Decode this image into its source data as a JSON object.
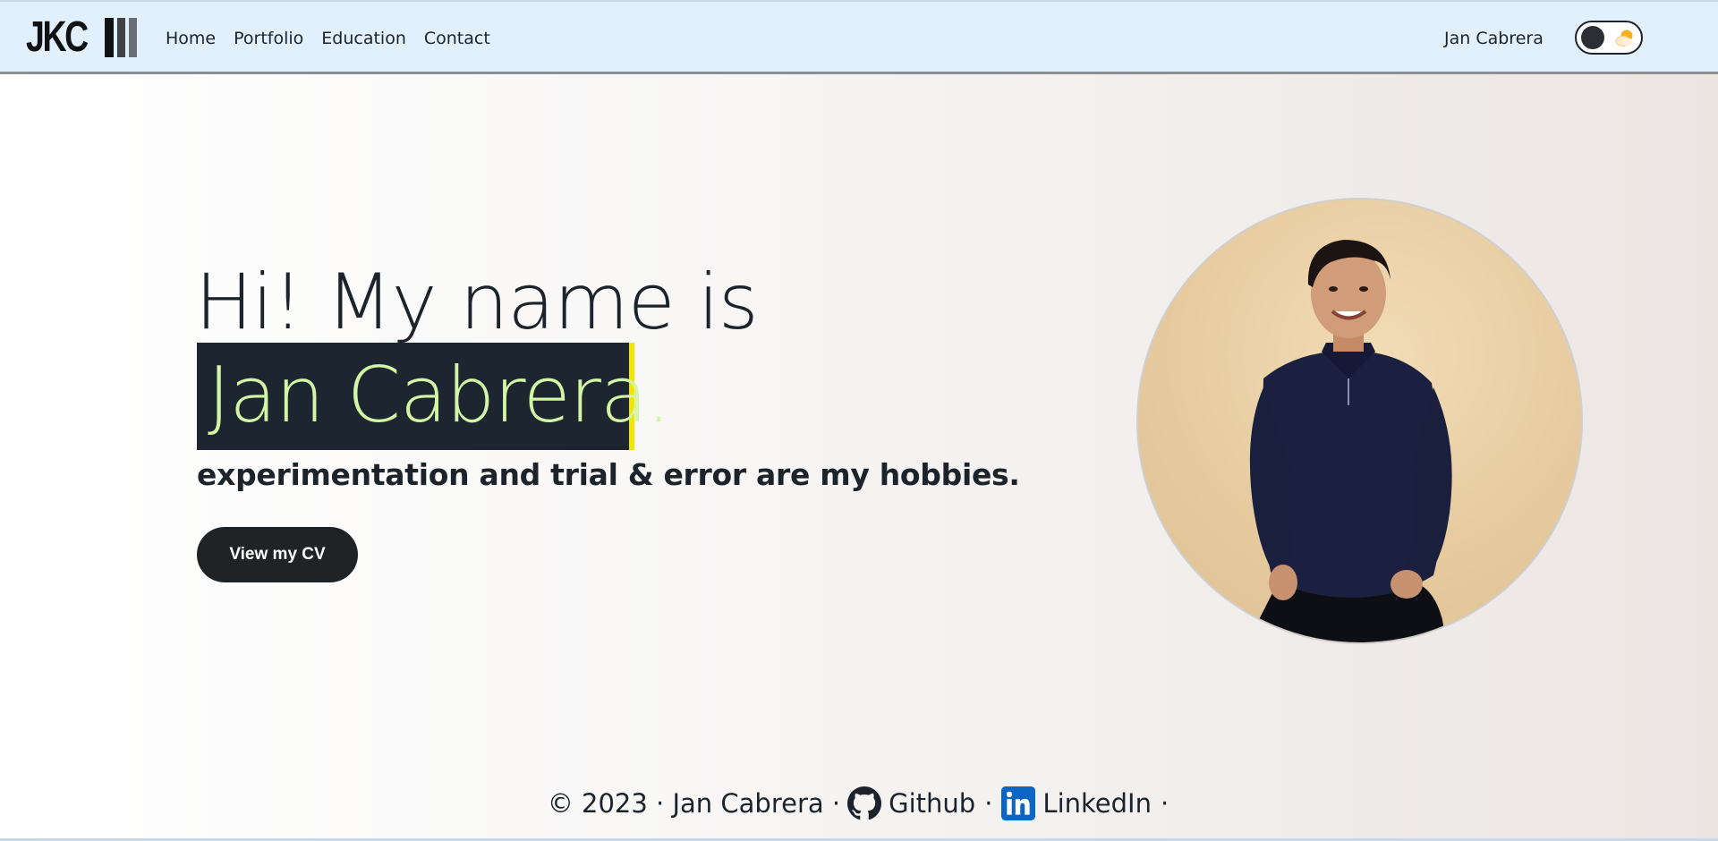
{
  "navbar": {
    "brand_text": "JKC",
    "links": [
      {
        "label": "Home"
      },
      {
        "label": "Portfolio"
      },
      {
        "label": "Education"
      },
      {
        "label": "Contact"
      }
    ],
    "user_name": "Jan Cabrera"
  },
  "hero": {
    "greeting": "Hi! My name is",
    "name": "Jan Cabrera.",
    "tagline": "experimentation and trial & error are my hobbies.",
    "cv_button_label": "View my CV"
  },
  "footer": {
    "copyright": "© 2023 · Jan Cabrera ·",
    "github_label": "Github",
    "separator": "·",
    "linkedin_label": "LinkedIn",
    "trailing": "·"
  },
  "icons": {
    "theme_toggle": "moon-sun-toggle-icon",
    "github": "github-icon",
    "linkedin": "linkedin-icon"
  },
  "colors": {
    "navbar_bg": "#e1f0fc",
    "name_highlight_bg": "#1d2630",
    "name_text": "#d3f5a6",
    "cursor_accent": "#f2e600",
    "button_bg": "#1f2326",
    "linkedin_blue": "#0a66c2"
  }
}
